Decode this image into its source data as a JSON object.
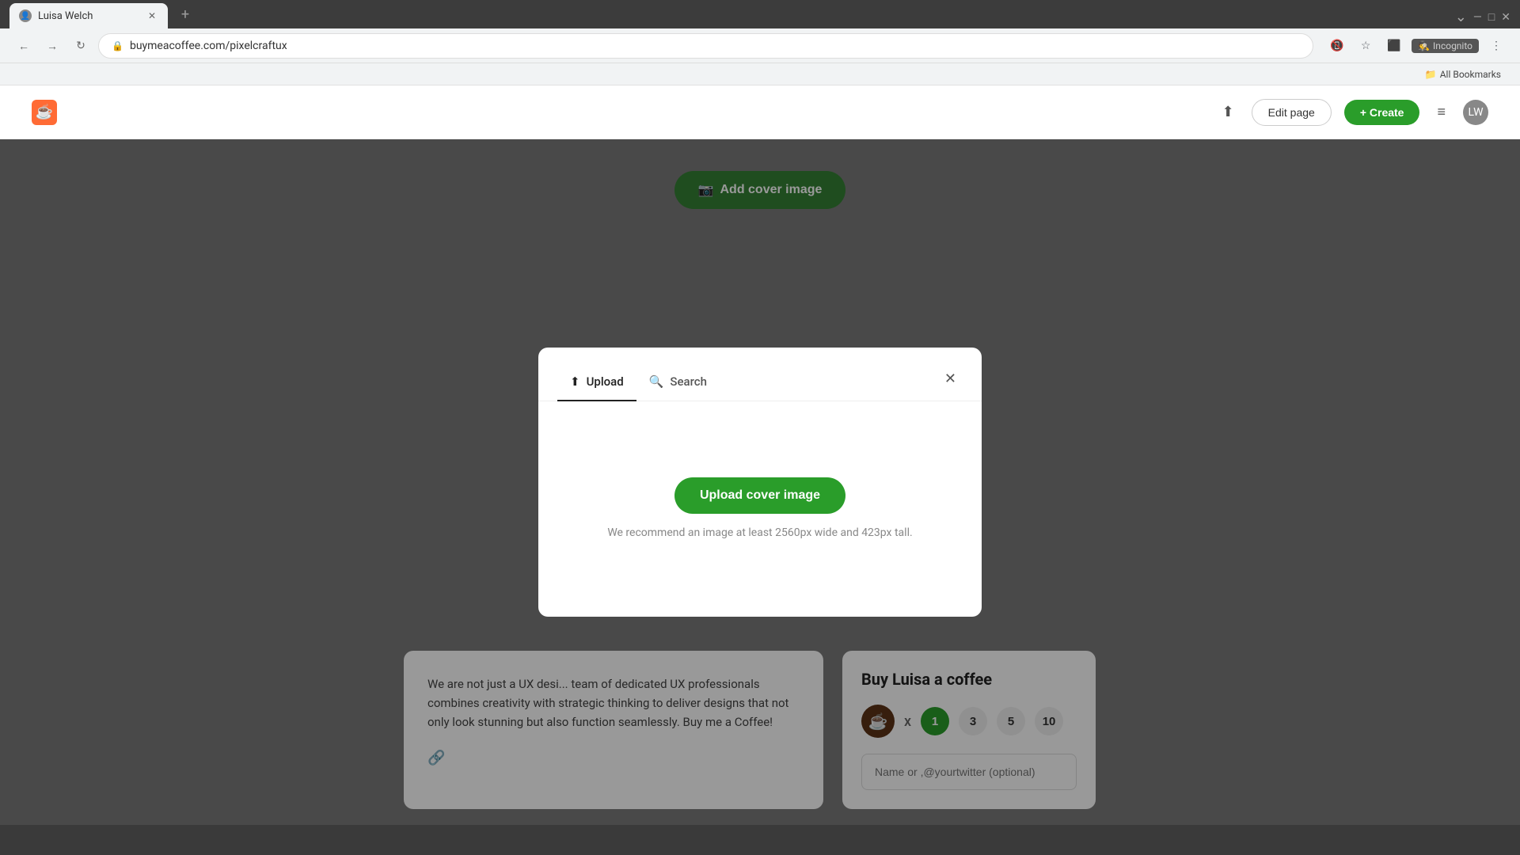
{
  "browser": {
    "tab_title": "Luisa Welch",
    "url": "buymeacoffee.com/pixelcraftux",
    "incognito_label": "Incognito",
    "bookmarks_label": "All Bookmarks"
  },
  "site_header": {
    "logo_label": "Buy Me a Coffee",
    "share_icon": "↑",
    "edit_page_label": "Edit page",
    "create_label": "+ Create",
    "menu_icon": "≡"
  },
  "page": {
    "add_cover_label": "Add cover image",
    "bio_text": "We are not just a UX desi... team of dedicated UX professionals combines creativity with strategic thinking to deliver designs that not only look stunning but also function seamlessly. Buy me a Coffee!",
    "widget_title": "Buy Luisa a coffee",
    "multiplier": "x",
    "qty_options": [
      "1",
      "3",
      "5",
      "10"
    ],
    "selected_qty": "1",
    "name_placeholder": "Name or ,@yourtwitter (optional)"
  },
  "modal": {
    "upload_tab_label": "Upload",
    "search_tab_label": "Search",
    "active_tab": "upload",
    "upload_btn_label": "Upload cover image",
    "hint_text": "We recommend an image at least 2560px wide and 423px tall.",
    "close_icon": "✕"
  },
  "icons": {
    "upload_icon": "⬆",
    "search_icon": "🔍",
    "camera_icon": "📷",
    "link_icon": "🔗",
    "coffee_emoji": "☕",
    "lock_icon": "🔒"
  }
}
